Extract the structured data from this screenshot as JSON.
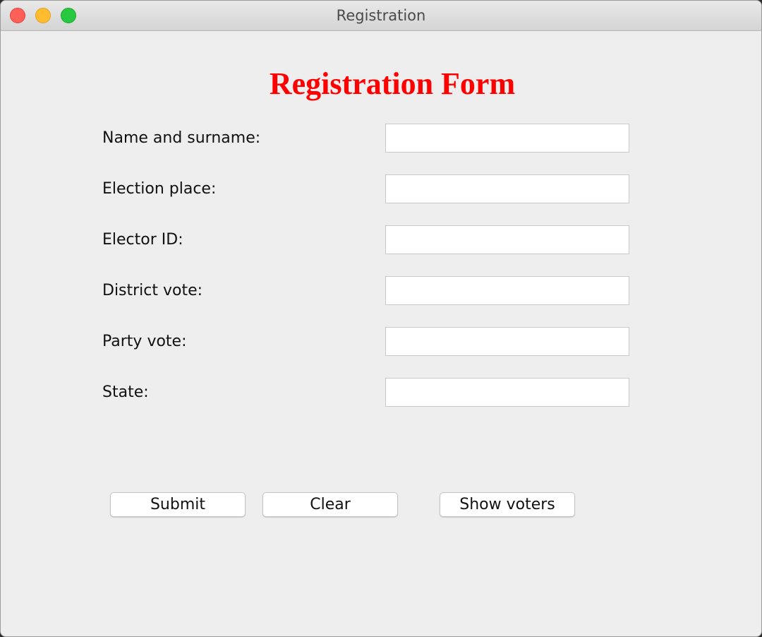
{
  "window": {
    "title": "Registration"
  },
  "form": {
    "heading": "Registration Form",
    "heading_color": "#ff0000",
    "fields": [
      {
        "label": "Name and surname:",
        "value": ""
      },
      {
        "label": "Election place:",
        "value": ""
      },
      {
        "label": "Elector ID:",
        "value": ""
      },
      {
        "label": "District vote:",
        "value": ""
      },
      {
        "label": "Party vote:",
        "value": ""
      },
      {
        "label": "State:",
        "value": ""
      }
    ]
  },
  "buttons": {
    "submit_label": "Submit",
    "clear_label": "Clear",
    "show_voters_label": "Show voters"
  },
  "colors": {
    "window_bg": "#eeeeee",
    "close": "#fe5f57",
    "minimize": "#febc2e",
    "zoom": "#28c840"
  }
}
